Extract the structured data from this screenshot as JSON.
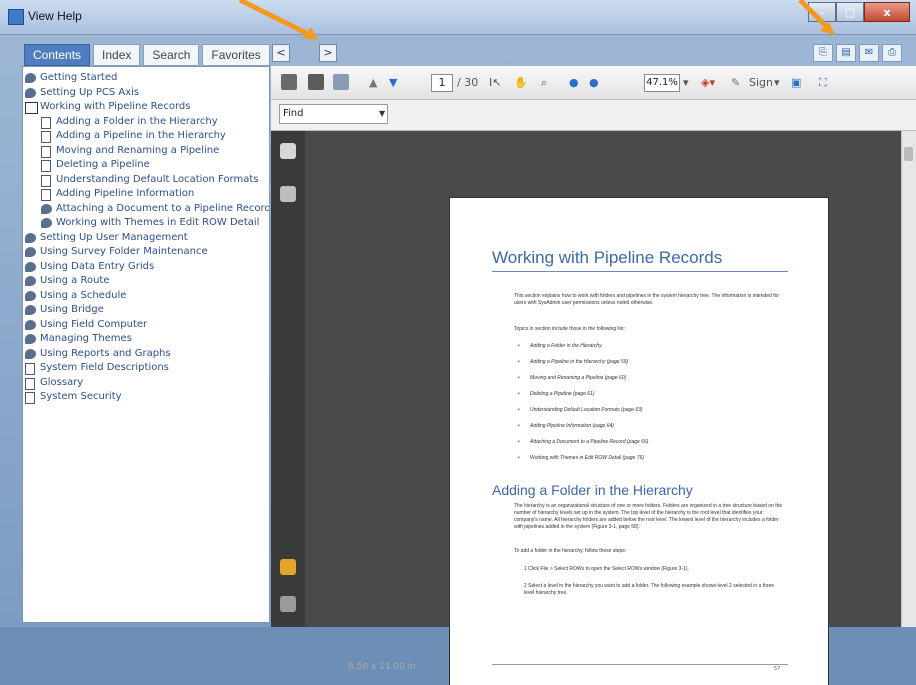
{
  "window": {
    "title": "View Help",
    "buttons": [
      "–",
      "□",
      "x"
    ]
  },
  "tabs": [
    "Contents",
    "Index",
    "Search",
    "Favorites"
  ],
  "nav": {
    "back": "<",
    "forward": ">"
  },
  "tree": [
    {
      "label": "Getting Started",
      "icon": "gear-icon",
      "indent": 0
    },
    {
      "label": "Setting Up PCS Axis",
      "icon": "gear-icon",
      "indent": 0
    },
    {
      "label": "Working with Pipeline Records",
      "icon": "book-icon",
      "indent": 0
    },
    {
      "label": "Adding a Folder in the Hierarchy",
      "icon": "doc-icon",
      "indent": 1
    },
    {
      "label": "Adding a Pipeline in the Hierarchy",
      "icon": "doc-icon",
      "indent": 1
    },
    {
      "label": "Moving and Renaming a Pipeline",
      "icon": "doc-icon",
      "indent": 1
    },
    {
      "label": "Deleting a Pipeline",
      "icon": "doc-icon",
      "indent": 1
    },
    {
      "label": "Understanding Default Location Formats",
      "icon": "doc-icon",
      "indent": 1
    },
    {
      "label": "Adding Pipeline Information",
      "icon": "doc-icon",
      "indent": 1
    },
    {
      "label": "Attaching a Document to a Pipeline Record",
      "icon": "gear-icon",
      "indent": 1
    },
    {
      "label": "Working with Themes in Edit ROW Detail",
      "icon": "gear-icon",
      "indent": 1
    },
    {
      "label": "Setting Up User Management",
      "icon": "gear-icon",
      "indent": 0
    },
    {
      "label": "Using Survey Folder Maintenance",
      "icon": "gear-icon",
      "indent": 0
    },
    {
      "label": "Using Data Entry Grids",
      "icon": "gear-icon",
      "indent": 0
    },
    {
      "label": "Using a Route",
      "icon": "gear-icon",
      "indent": 0
    },
    {
      "label": "Using a Schedule",
      "icon": "gear-icon",
      "indent": 0
    },
    {
      "label": "Using Bridge",
      "icon": "gear-icon",
      "indent": 0
    },
    {
      "label": "Using Field Computer",
      "icon": "gear-icon",
      "indent": 0
    },
    {
      "label": "Managing Themes",
      "icon": "gear-icon",
      "indent": 0
    },
    {
      "label": "Using Reports and Graphs",
      "icon": "gear-icon",
      "indent": 0
    },
    {
      "label": "System Field Descriptions",
      "icon": "doc-icon",
      "indent": 0
    },
    {
      "label": "Glossary",
      "icon": "doc-icon",
      "indent": 0
    },
    {
      "label": "System Security",
      "icon": "doc-icon",
      "indent": 0
    }
  ],
  "toolbar": {
    "current_page": "1",
    "total_pages": "/ 30",
    "zoom": "47.1%",
    "sign": "Sign"
  },
  "find": {
    "placeholder": "Find"
  },
  "page": {
    "title": "Working with Pipeline Records",
    "intro": "This section explains how to work with folders and pipelines in the system hierarchy tree. The information is intended for users with SysAdmin user permissions unless noted otherwise.",
    "topics_intro": "Topics in section include those in the following list:",
    "bullets": [
      "Adding a Folder in the Hierarchy",
      "Adding a Pipeline in the Hierarchy (page 59)",
      "Moving and Renaming a Pipeline (page 60)",
      "Deleting a Pipeline (page 61)",
      "Understanding Default Location Formats (page 63)",
      "Adding Pipeline Information (page 64)",
      "Attaching a Document to a Pipeline Record (page 66)",
      "Working with Themes in Edit ROW Detail (page 76)"
    ],
    "section2_title": "Adding a Folder in the Hierarchy",
    "section2_para": "The hierarchy is an organizational structure of one or more folders. Folders are organized in a tree structure based on the number of hierarchy levels set up in the system. The top level of the hierarchy is the root level that identifies your company's name. All hierarchy folders are added below the root level. The lowest level of the hierarchy includes a folder with pipelines added in the system (Figure 3-1, page 58).",
    "section2_intro": "To add a folder in the hierarchy, follow these steps:",
    "steps": [
      "1   Click File > Select ROWs to open the Select ROWs window (Figure 3-1).",
      "2   Select a level in the hierarchy you want to add a folder. The following example shows level 2 selected in a three level hierarchy tree."
    ],
    "page_number": "57"
  },
  "page_size": "8.50 x 11.00 in",
  "colors": {
    "accent": "#3d67a8",
    "arrow": "#f39a1e"
  }
}
